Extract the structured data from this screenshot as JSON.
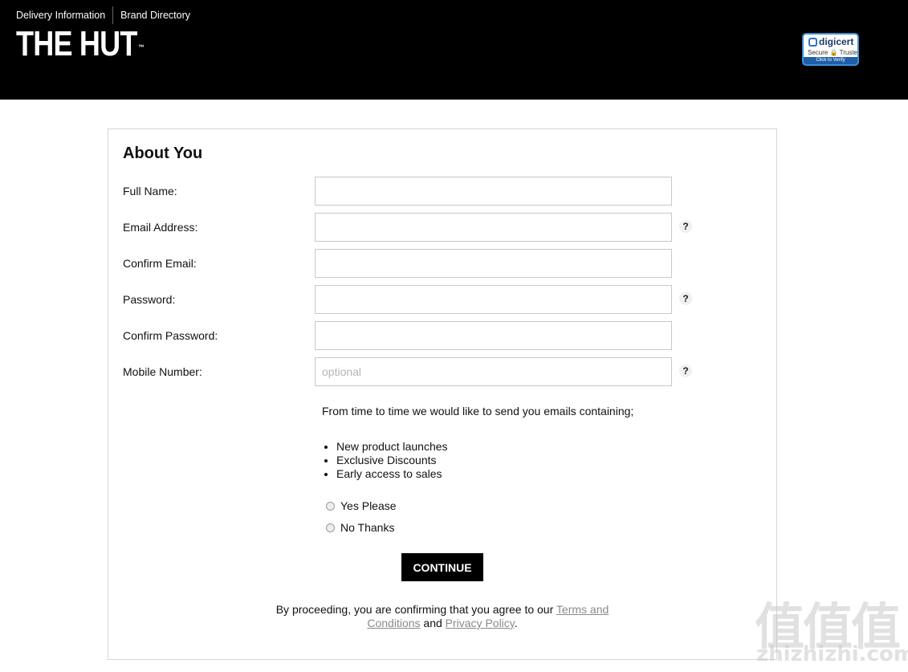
{
  "header": {
    "links": [
      {
        "label": "Delivery Information"
      },
      {
        "label": "Brand Directory"
      }
    ],
    "logo_text": "THE HUT",
    "logo_tm": "™",
    "badge": {
      "brand": "digicert",
      "sub": "Secure 🔒 Trusted",
      "verify": "Click to Verify",
      "accent": "#1e5fa8"
    }
  },
  "form": {
    "title": "About You",
    "fields": [
      {
        "label": "Full Name:",
        "value": "",
        "placeholder": "",
        "help": ""
      },
      {
        "label": "Email Address:",
        "value": "",
        "placeholder": "",
        "help": "?"
      },
      {
        "label": "Confirm Email:",
        "value": "",
        "placeholder": "",
        "help": ""
      },
      {
        "label": "Password:",
        "value": "",
        "placeholder": "",
        "help": "?"
      },
      {
        "label": "Confirm Password:",
        "value": "",
        "placeholder": "",
        "help": ""
      },
      {
        "label": "Mobile Number:",
        "value": "",
        "placeholder": "optional",
        "help": "?"
      }
    ],
    "marketing_intro": "From time to time we would like to send you emails containing;",
    "marketing_items": [
      "New product launches",
      "Exclusive Discounts",
      "Early access to sales"
    ],
    "options": [
      {
        "label": "Yes Please",
        "selected": false
      },
      {
        "label": "No Thanks",
        "selected": false
      }
    ],
    "continue_label": "CONTINUE",
    "legal": {
      "prefix": "By proceeding, you are confirming that you agree to our ",
      "terms": "Terms and Conditions",
      "and": " and ",
      "privacy": "Privacy Policy",
      "suffix": "."
    }
  },
  "watermark": {
    "chars": "值值值",
    "latin": "zhizhizhi.com"
  }
}
